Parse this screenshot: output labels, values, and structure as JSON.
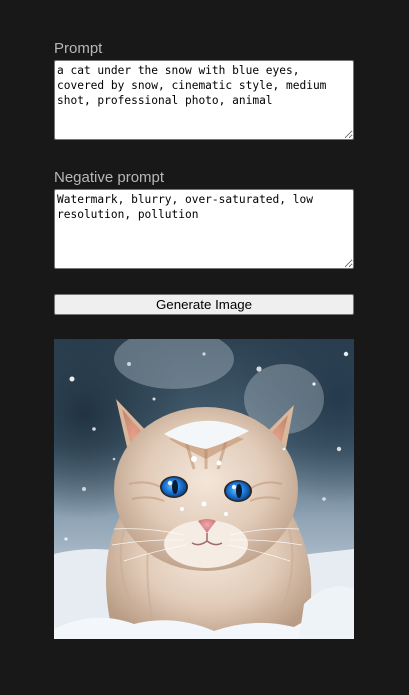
{
  "form": {
    "prompt_label": "Prompt",
    "prompt_value": "a cat under the snow with blue eyes, covered by snow, cinematic style, medium shot, professional photo, animal",
    "negative_prompt_label": "Negative prompt",
    "negative_prompt_value": "Watermark, blurry, over-saturated, low resolution, pollution",
    "generate_button_label": "Generate Image"
  },
  "result": {
    "image_subject": "cat in snow with blue eyes",
    "colors": {
      "background": "#181818",
      "fur": "#e8d6c6",
      "fur_orange": "#c99a76",
      "eyes": "#1f7fe0",
      "snow": "#eef2f7",
      "sky": "#3f5466"
    }
  }
}
